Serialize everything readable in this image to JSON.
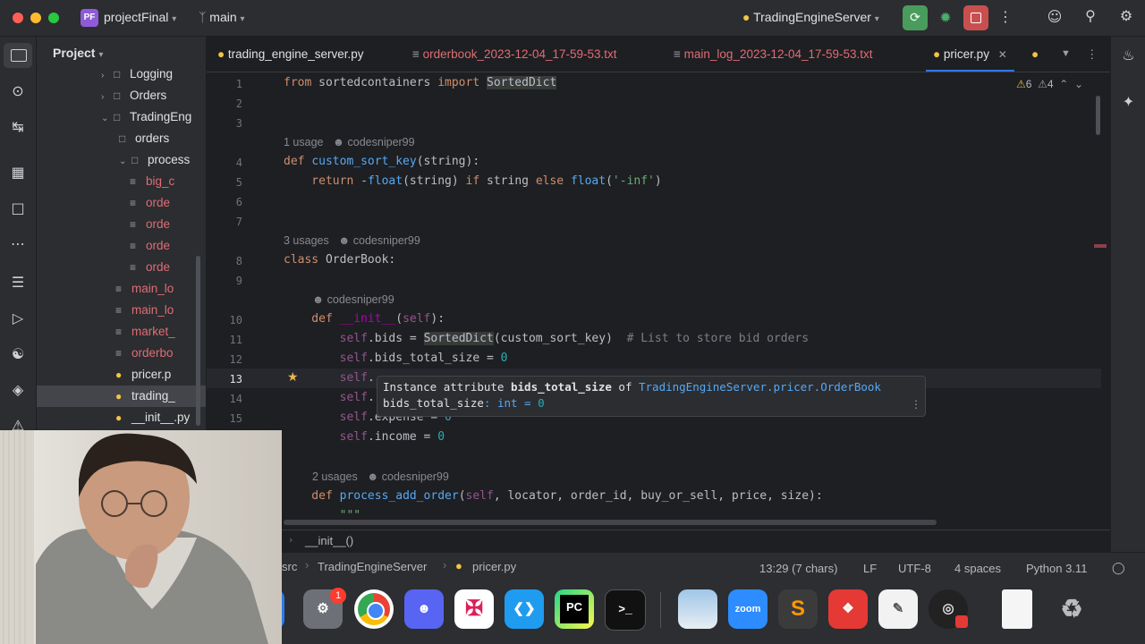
{
  "titlebar": {
    "project_badge": "PF",
    "project_name": "projectFinal",
    "branch": "main",
    "run_config": "TradingEngineServer"
  },
  "project_panel": {
    "title": "Project",
    "rows": [
      {
        "label": "Logging",
        "indent": 0,
        "kind": "folder-collapsed"
      },
      {
        "label": "Orders",
        "indent": 0,
        "kind": "folder-collapsed"
      },
      {
        "label": "TradingEng",
        "indent": 0,
        "kind": "folder-open"
      },
      {
        "label": "orders",
        "indent": 1,
        "kind": "folder"
      },
      {
        "label": "process",
        "indent": 1,
        "kind": "folder-open"
      },
      {
        "label": "big_c",
        "indent": 2,
        "kind": "file-red"
      },
      {
        "label": "orde",
        "indent": 2,
        "kind": "file-red"
      },
      {
        "label": "orde",
        "indent": 2,
        "kind": "file-red"
      },
      {
        "label": "orde",
        "indent": 2,
        "kind": "file-red"
      },
      {
        "label": "orde",
        "indent": 2,
        "kind": "file-red"
      },
      {
        "label": "main_lo",
        "indent": 1,
        "kind": "file-red"
      },
      {
        "label": "main_lo",
        "indent": 1,
        "kind": "file-red"
      },
      {
        "label": "market_",
        "indent": 1,
        "kind": "file-red"
      },
      {
        "label": "orderbo",
        "indent": 1,
        "kind": "file-red"
      },
      {
        "label": "pricer.p",
        "indent": 1,
        "kind": "py"
      },
      {
        "label": "trading_",
        "indent": 1,
        "kind": "py-selected"
      },
      {
        "label": "__init__.py",
        "indent": 0,
        "kind": "py"
      }
    ]
  },
  "tabs": [
    {
      "label": "trading_engine_server.py",
      "kind": "py"
    },
    {
      "label": "orderbook_2023-12-04_17-59-53.txt",
      "kind": "txt-red"
    },
    {
      "label": "main_log_2023-12-04_17-59-53.txt",
      "kind": "txt-red"
    },
    {
      "label": "pricer.py",
      "kind": "py-active"
    }
  ],
  "inspections": {
    "warnings": "6",
    "weak_warnings": "4"
  },
  "code": {
    "line_numbers": [
      "1",
      "2",
      "3",
      "4",
      "5",
      "6",
      "7",
      "8",
      "9",
      "10",
      "11",
      "12",
      "13",
      "14",
      "15"
    ],
    "hints": {
      "h1_usage": "1 usage",
      "h1_author": "codesniper99",
      "h2_usage": "3 usages",
      "h2_author": "codesniper99",
      "h3_author": "codesniper99",
      "h4_usage": "2 usages",
      "h4_author": "codesniper99"
    },
    "l1": [
      "from",
      " sortedcontainers ",
      "import",
      " ",
      "SortedDict"
    ],
    "l4": [
      "def",
      " ",
      "custom_sort_key",
      "(string):"
    ],
    "l5": [
      "    return",
      " -",
      "float",
      "(string) ",
      "if",
      " string ",
      "else",
      " ",
      "float",
      "(",
      "'-inf'",
      ")"
    ],
    "l8": [
      "class",
      " OrderBook:"
    ],
    "l10": [
      "    def",
      " ",
      "__init__",
      "(",
      "self",
      "):"
    ],
    "l11": [
      "        ",
      "self",
      ".bids = ",
      "SortedDict",
      "(custom_sort_key)  ",
      "# List to store bid orders"
    ],
    "l12": [
      "        ",
      "self",
      ".bids_total_size = ",
      "0"
    ],
    "l13": [
      "        ",
      "self",
      "."
    ],
    "l14": [
      "        ",
      "self",
      "."
    ],
    "l15": [
      "        ",
      "self",
      ".expense = ",
      "0"
    ],
    "l16": [
      "        ",
      "self",
      ".income = ",
      "0"
    ],
    "l18": [
      "    def",
      " ",
      "process_add_order",
      "(",
      "self",
      ", locator, order_id, buy_or_sell, price, size):"
    ],
    "l19": "        \"\"\""
  },
  "tooltip": {
    "line1_prefix": "Instance attribute ",
    "line1_attr": "bids_total_size",
    "line1_of": " of ",
    "line1_class": "TradingEngineServer.pricer.OrderBook",
    "line2_name": "bids_total_size",
    "line2_type": ": int = ",
    "line2_value": "0"
  },
  "breadcrumb_structure": "__init__()",
  "status": {
    "path_start": "src",
    "path_folder": "TradingEngineServer",
    "path_file": "pricer.py",
    "position": "13:29 (7 chars)",
    "line_sep": "LF",
    "encoding": "UTF-8",
    "indent": "4 spaces",
    "interpreter": "Python 3.11"
  },
  "dock": {
    "settings_badge": "1",
    "pycharm_label": "PC",
    "terminal_label": ">_",
    "zoom_label": "zoom"
  },
  "colors": {
    "accent": "#3574f0",
    "run_green": "#4a9c5d",
    "stop_red": "#c94f4f"
  }
}
